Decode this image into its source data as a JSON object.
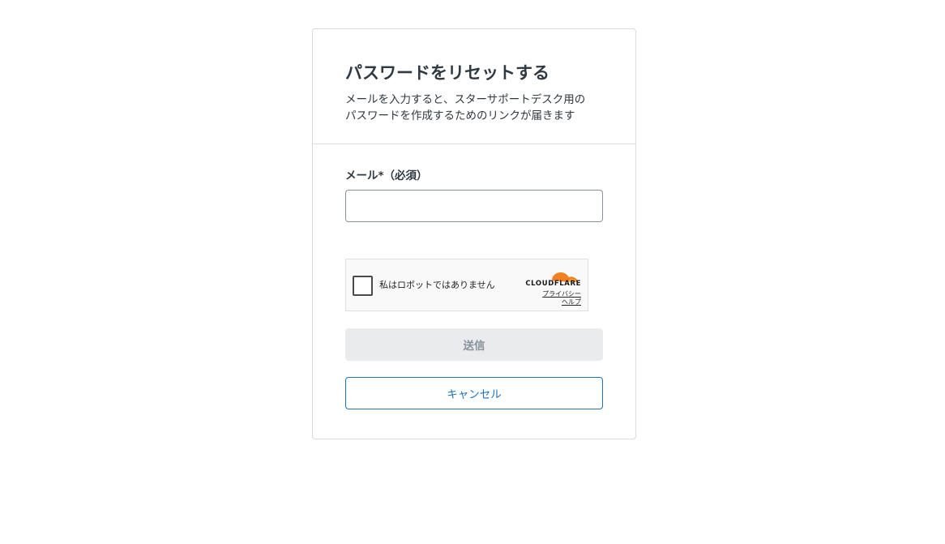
{
  "header": {
    "title": "パスワードをリセットする",
    "description_line1": "メールを入力すると、スターサポートデスク用の",
    "description_line2": "パスワードを作成するためのリンクが届きます"
  },
  "form": {
    "email_label": "メール*（必須）",
    "email_value": "",
    "email_placeholder": ""
  },
  "turnstile": {
    "checkbox_label": "私はロボットではありません",
    "brand": "CLOUDFLARE",
    "privacy_link": "プライバシー",
    "help_link": "ヘルプ",
    "logo_icon": "cloudflare-cloud-icon",
    "brand_color": "#f38020"
  },
  "actions": {
    "submit_label": "送信",
    "cancel_label": "キャンセル"
  },
  "colors": {
    "accent": "#1f73b7",
    "border": "#d8dcde",
    "disabled_bg": "#e9ebed",
    "disabled_text": "#87929d"
  }
}
